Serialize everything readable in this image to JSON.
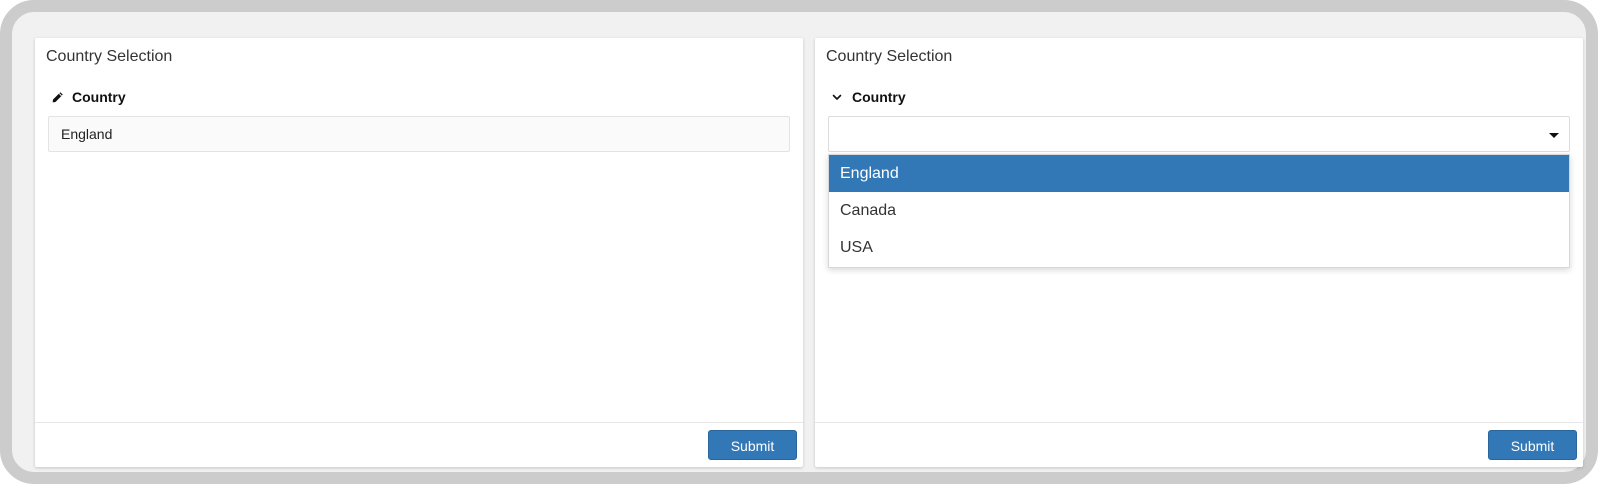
{
  "left_panel": {
    "title": "Country Selection",
    "field_label": "Country",
    "field_icon": "pencil-icon",
    "value": "England",
    "submit_label": "Submit"
  },
  "right_panel": {
    "title": "Country Selection",
    "field_label": "Country",
    "field_icon": "chevron-down-icon",
    "selected_value": "",
    "dropdown_options": [
      {
        "label": "England",
        "highlighted": true
      },
      {
        "label": "Canada",
        "highlighted": false
      },
      {
        "label": "USA",
        "highlighted": false
      }
    ],
    "submit_label": "Submit"
  },
  "colors": {
    "primary": "#3277b6",
    "frame": "#cccccc",
    "background": "#f1f1f1"
  }
}
